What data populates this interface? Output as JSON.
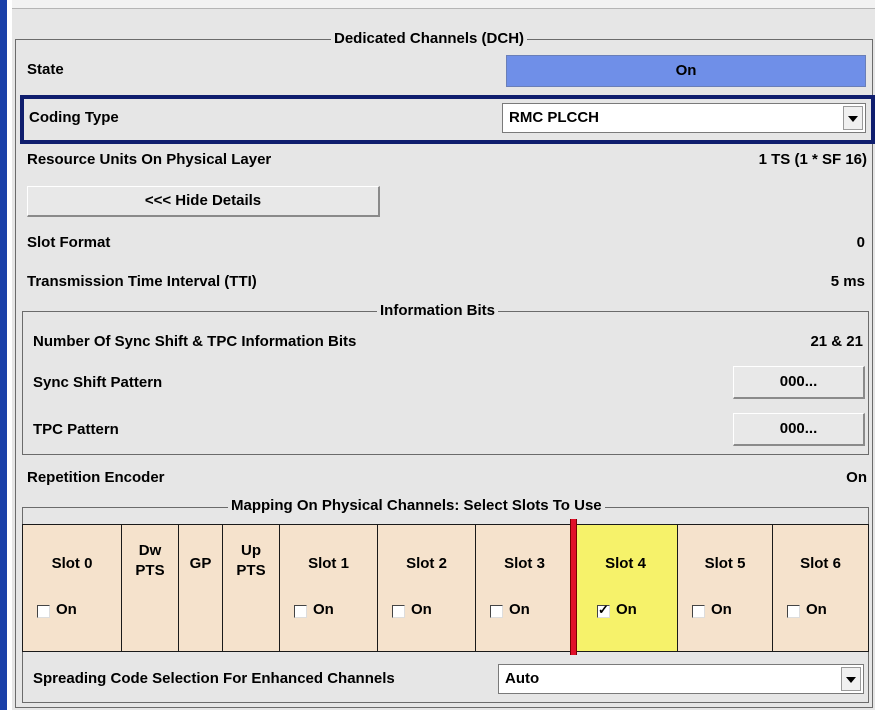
{
  "dch": {
    "group_title": "Dedicated Channels (DCH)",
    "state_label": "State",
    "state_value": "On",
    "coding_type_label": "Coding Type",
    "coding_type_value": "RMC PLCCH",
    "resource_units_label": "Resource Units On Physical Layer",
    "resource_units_value": "1 TS (1 * SF 16)",
    "hide_details_button": "<<< Hide Details",
    "slot_format_label": "Slot Format",
    "slot_format_value": "0",
    "tti_label": "Transmission Time Interval (TTI)",
    "tti_value": "5 ms"
  },
  "info_bits": {
    "group_title": "Information Bits",
    "num_bits_label": "Number Of Sync Shift & TPC Information Bits",
    "num_bits_value": "21 & 21",
    "sync_shift_label": "Sync Shift Pattern",
    "sync_shift_button": "000...",
    "tpc_label": "TPC Pattern",
    "tpc_button": "000..."
  },
  "repetition": {
    "label": "Repetition Encoder",
    "value": "On"
  },
  "mapping": {
    "group_title": "Mapping On Physical Channels: Select Slots To Use",
    "slots": [
      {
        "name": "Slot 0",
        "on_label": "On",
        "checked": false
      },
      {
        "name1": "Dw",
        "name2": "PTS"
      },
      {
        "name": "GP"
      },
      {
        "name1": "Up",
        "name2": "PTS"
      },
      {
        "name": "Slot 1",
        "on_label": "On",
        "checked": false
      },
      {
        "name": "Slot 2",
        "on_label": "On",
        "checked": false
      },
      {
        "name": "Slot 3",
        "on_label": "On",
        "checked": false
      },
      {
        "name": "Slot 4",
        "on_label": "On",
        "checked": true
      },
      {
        "name": "Slot 5",
        "on_label": "On",
        "checked": false
      },
      {
        "name": "Slot 6",
        "on_label": "On",
        "checked": false
      }
    ],
    "spreading_label": "Spreading Code Selection For Enhanced Channels",
    "spreading_value": "Auto"
  },
  "colors": {
    "accent_bar": "#1a3fa8",
    "state_on": "#6f8fe8",
    "selected_slot": "#f6f26a",
    "slot_bg": "#f5e2cc",
    "marker": "#e0102a"
  }
}
